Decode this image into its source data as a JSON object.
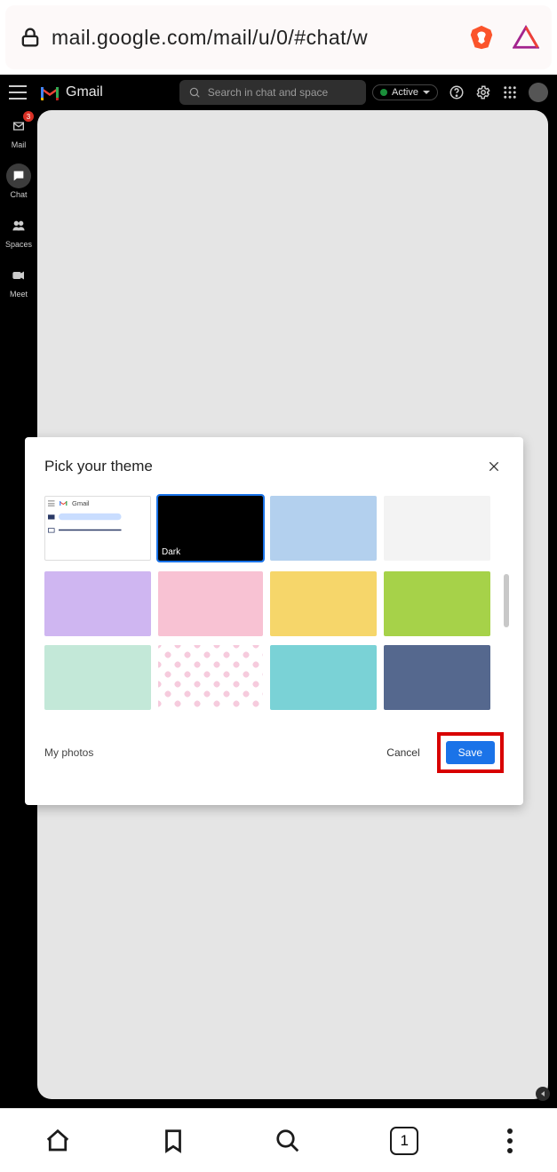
{
  "urlbar": {
    "url": "mail.google.com/mail/u/0/#chat/w"
  },
  "header": {
    "product": "Gmail",
    "search_placeholder": "Search in chat and space",
    "status": "Active"
  },
  "rail": {
    "mail": {
      "label": "Mail",
      "badge": "3"
    },
    "chat": {
      "label": "Chat"
    },
    "spaces": {
      "label": "Spaces"
    },
    "meet": {
      "label": "Meet"
    }
  },
  "dialog": {
    "title": "Pick your theme",
    "themes": [
      {
        "id": "default",
        "label": "Gmail",
        "selected": false
      },
      {
        "id": "dark",
        "label": "Dark",
        "selected": true,
        "color": "#000000"
      },
      {
        "id": "blue",
        "label": "",
        "color": "#b3d0ee"
      },
      {
        "id": "softgray",
        "label": "",
        "color": "#f3f3f3"
      },
      {
        "id": "lavender",
        "label": "",
        "color": "#cfb6f1"
      },
      {
        "id": "rose",
        "label": "",
        "color": "#f8c2d3"
      },
      {
        "id": "mustard",
        "label": "",
        "color": "#f6d66a"
      },
      {
        "id": "wasabi",
        "label": "",
        "color": "#a6d249"
      },
      {
        "id": "mint",
        "label": "",
        "color": "#c3e8d8"
      },
      {
        "id": "cherry",
        "label": "",
        "color": "#fff",
        "pattern": "cherry-blossom"
      },
      {
        "id": "aqua",
        "label": "",
        "color": "#7ad2d6"
      },
      {
        "id": "dusk",
        "label": "",
        "color": "#55688e"
      }
    ],
    "my_photos": "My photos",
    "cancel": "Cancel",
    "save": "Save"
  },
  "bottombar": {
    "tab_count": "1"
  }
}
